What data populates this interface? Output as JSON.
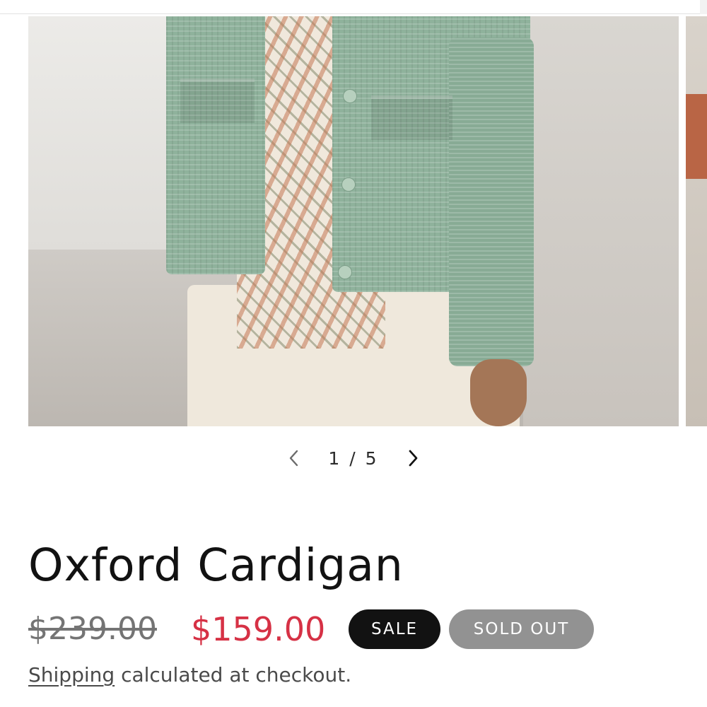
{
  "gallery": {
    "current_slide": "1",
    "separator": "/",
    "total_slides": "5",
    "prev_icon": "chevron-left-icon",
    "next_icon": "chevron-right-icon"
  },
  "product": {
    "title": "Oxford Cardigan",
    "regular_price": "$239.00",
    "sale_price": "$159.00",
    "badges": {
      "sale": "SALE",
      "sold_out": "SOLD OUT"
    },
    "shipping": {
      "link_text": "Shipping",
      "text": "calculated at checkout."
    }
  },
  "colors": {
    "sale_price": "#d63145",
    "sale_badge": "#121212",
    "sold_out_badge": "#929292",
    "text": "#121212"
  }
}
